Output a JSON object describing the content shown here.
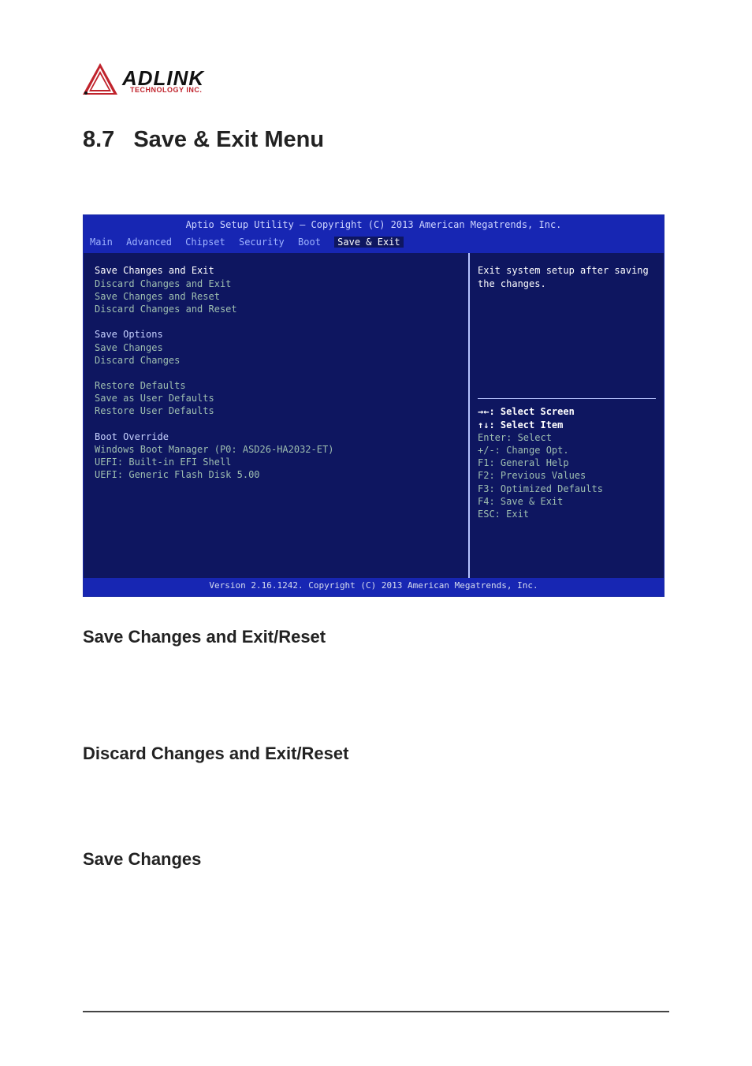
{
  "logo": {
    "brand": "ADLINK",
    "sub": "TECHNOLOGY INC."
  },
  "section": {
    "number": "8.7",
    "title": "Save & Exit Menu"
  },
  "headings": {
    "saveExit": "Save Changes and Exit/Reset",
    "discardExit": "Discard Changes and Exit/Reset",
    "saveChanges": "Save Changes"
  },
  "bios": {
    "title": "Aptio Setup Utility – Copyright (C) 2013 American Megatrends, Inc.",
    "tabs": {
      "main": "Main",
      "advanced": "Advanced",
      "chipset": "Chipset",
      "security": "Security",
      "boot": "Boot",
      "saveExit": "Save & Exit"
    },
    "left": {
      "items1": [
        "Save Changes and Exit",
        "Discard Changes and Exit",
        "Save Changes and Reset",
        "Discard Changes and Reset"
      ],
      "groupSaveOptions": "Save Options",
      "items2": [
        "Save Changes",
        "Discard Changes"
      ],
      "items3": [
        "Restore Defaults",
        "Save as User Defaults",
        "Restore User Defaults"
      ],
      "groupBootOverride": "Boot Override",
      "items4": [
        "Windows Boot Manager (P0: ASD26-HA2032-ET)",
        "UEFI: Built-in EFI Shell",
        "UEFI: Generic Flash Disk 5.00"
      ]
    },
    "right": {
      "helpText": "Exit system setup after saving the changes.",
      "keys": {
        "selScreen": "→←: Select Screen",
        "selItem": "↑↓: Select Item",
        "enter": "Enter: Select",
        "change": "+/-: Change Opt.",
        "f1": "F1: General Help",
        "f2": "F2: Previous Values",
        "f3": "F3: Optimized Defaults",
        "f4": "F4: Save & Exit",
        "esc": "ESC: Exit"
      }
    },
    "footer": "Version 2.16.1242. Copyright (C) 2013 American Megatrends, Inc."
  }
}
